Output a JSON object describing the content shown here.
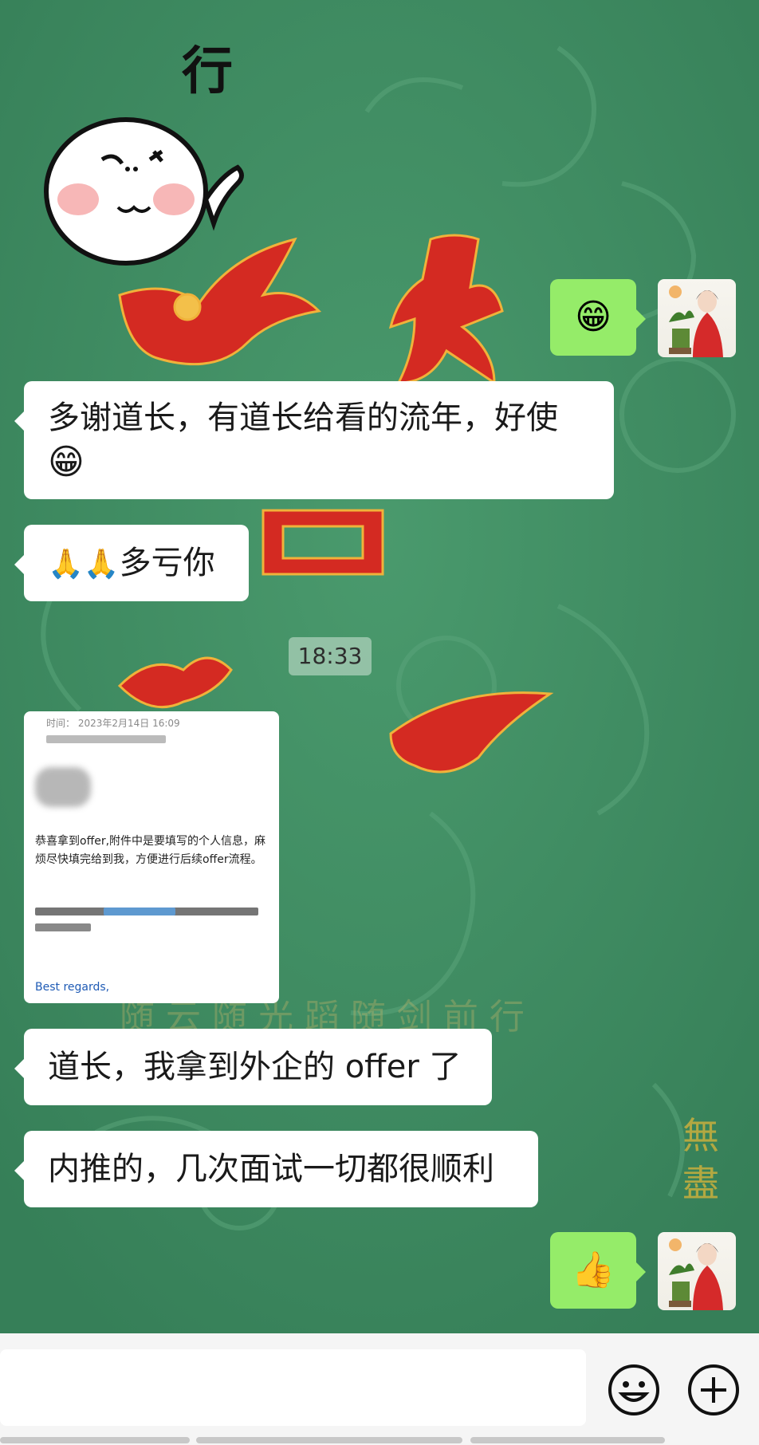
{
  "chat": {
    "sticker_caption": "行",
    "timestamp": "18:33",
    "messages": [
      {
        "side": "right",
        "type": "emoji",
        "content": "😁"
      },
      {
        "side": "left",
        "type": "text",
        "line1": "多谢道长，有道长给看的流年，好使",
        "line2": "😁"
      },
      {
        "side": "left",
        "type": "text",
        "prefix": "🙏🙏",
        "text": "多亏你"
      },
      {
        "side": "left",
        "type": "image",
        "kind": "email-screenshot"
      },
      {
        "side": "left",
        "type": "text",
        "text": "道长，我拿到外企的 offer 了"
      },
      {
        "side": "left",
        "type": "text",
        "text": "内推的，几次面试一切都很顺利"
      },
      {
        "side": "right",
        "type": "emoji",
        "content": "👍"
      }
    ]
  },
  "email": {
    "time_label": "时间：",
    "time_value": "2023年2月14日 16:09",
    "body": "恭喜拿到offer,附件中是要填写的个人信息，麻烦尽快填完给到我，方便进行后续offer流程。",
    "regards": "Best regards,"
  },
  "input": {
    "emoji_icon": "smile-icon",
    "plus_icon": "plus-icon"
  },
  "colors": {
    "background_green": "#3f8e63",
    "bubble_left": "#ffffff",
    "bubble_right": "#95ec69",
    "calligraphy_red": "#d42a22"
  }
}
